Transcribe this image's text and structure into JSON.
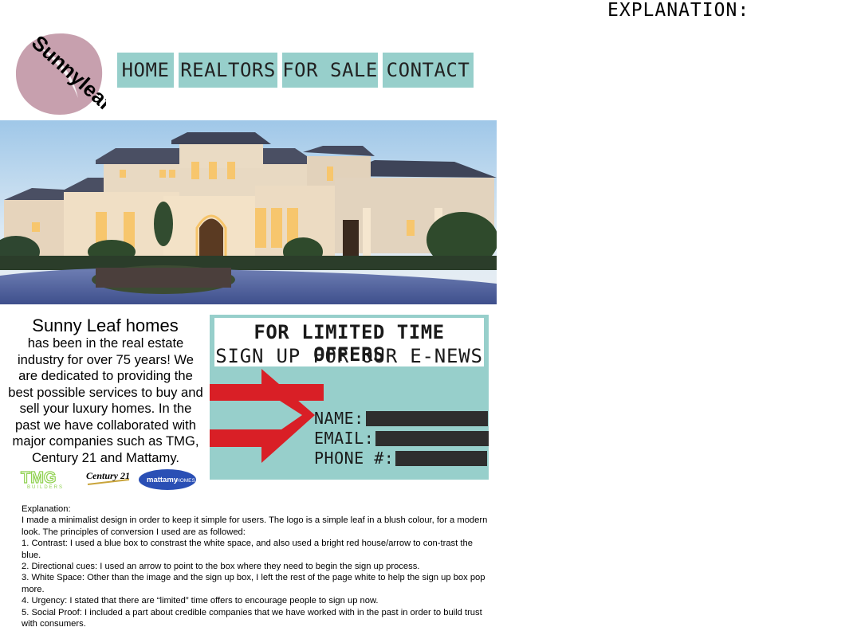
{
  "explanation_heading": "EXPLANATION:",
  "logo": {
    "text": "Sunnyleaf",
    "color": "#c7a0ae"
  },
  "nav": [
    {
      "label": "HOME"
    },
    {
      "label": "REALTORS"
    },
    {
      "label": "FOR SALE"
    },
    {
      "label": "CONTACT"
    }
  ],
  "about": {
    "title": "Sunny Leaf homes",
    "body": "has been in the real estate industry for over 75 years! We are dedicated to providing the best possible services to buy and sell your luxury homes. In the past we have collaborated with major companies such as TMG, Century 21 and Mattamy."
  },
  "partners": [
    {
      "name": "TMG",
      "sub": "BUILDERS"
    },
    {
      "name": "Century 21"
    },
    {
      "name": "mattamy",
      "sub": "HOMES"
    }
  ],
  "signup": {
    "line1": "FOR LIMITED TIME OFFERS",
    "line2": "SIGN UP FOR OUR E-NEWS",
    "fields": [
      {
        "label": "NAME:",
        "value": ""
      },
      {
        "label": "EMAIL:",
        "value": ""
      },
      {
        "label": "PHONE #:",
        "value": ""
      }
    ],
    "accent": "#97cfcb",
    "arrow_color": "#d91f26"
  },
  "explanation": [
    "Explanation:",
    "I made a minimalist design in order to keep it simple for users. The logo is a simple leaf in a blush colour, for a modern look. The principles of conversion I used are as followed:",
    "1. Contrast: I used a blue box to constrast the white space, and also used a bright red house/arrow to con-trast the blue.",
    "2. Directional cues: I used an arrow to point to the box where they need to begin the sign up process.",
    "3. White Space: Other than the image and the sign up box, I left the rest of the page white to help the sign up box pop more.",
    "4. Urgency: I stated that there are “limited” time offers to encourage people to sign up now.",
    "5. Social Proof: I included a part about credible companies that we have worked with in the past in order to build trust with consumers."
  ]
}
